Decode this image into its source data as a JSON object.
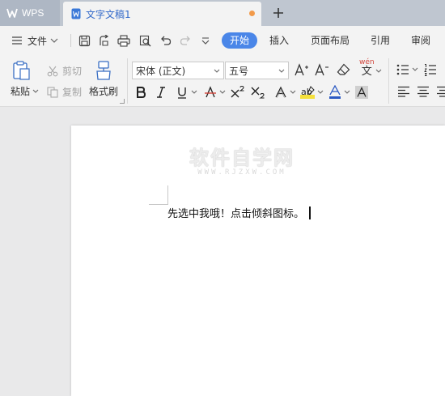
{
  "tabbar": {
    "app_label": "WPS",
    "document_tab_label": "文字文稿1",
    "new_tab_label": "+"
  },
  "menu": {
    "file_label": "文件",
    "tabs": [
      {
        "label": "开始",
        "active": true
      },
      {
        "label": "插入",
        "active": false
      },
      {
        "label": "页面布局",
        "active": false
      },
      {
        "label": "引用",
        "active": false
      },
      {
        "label": "审阅",
        "active": false
      }
    ]
  },
  "ribbon": {
    "paste_label": "粘贴",
    "cut_label": "剪切",
    "copy_label": "复制",
    "format_painter_label": "格式刷",
    "font_name": "宋体 (正文)",
    "font_size": "五号",
    "pinyin_label": "wén",
    "pinyin_glyph": "文"
  },
  "document": {
    "watermark_title": "软件自学网",
    "watermark_subtitle": "WWW.RJZXW.COM",
    "body_text": "先选中我哦！点击倾斜图标。"
  },
  "colors": {
    "accent": "#4a86e8",
    "tab_text": "#3168c9",
    "unsaved_dot": "#f29a4a",
    "highlight": "#f5e03b",
    "font_color_bar": "#2b59c3"
  }
}
